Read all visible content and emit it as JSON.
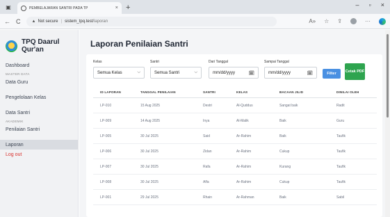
{
  "browser": {
    "tab_title": "PEMBELAJARAN SANTRI PADA TP",
    "tab_close": "×",
    "new_tab": "+",
    "window_controls": [
      "–",
      "▫",
      "×"
    ],
    "security": "Not secure",
    "url_host": "sistem_tpq.test",
    "url_path": "/laporan"
  },
  "sidebar": {
    "brand": "TPQ Daarul Qur'an",
    "items": {
      "dashboard": "Dashboard",
      "master_head": "MASTER DATA",
      "data_guru": "Data Guru",
      "pengelolaan_kelas": "Pengelolaan Kelas",
      "data_santri": "Data Santri",
      "akademik_head": "AKADEMIK",
      "penilaian_santri": "Penilaian Santri",
      "laporan": "Laporan",
      "logout": "Log out"
    }
  },
  "main": {
    "title": "Laporan Penilaian Santri",
    "filters": {
      "kelas_label": "Kelas",
      "kelas_value": "Semua Kelas",
      "santri_label": "Santri",
      "santri_value": "Semua Santri",
      "dari_label": "Dari Tanggal",
      "dari_placeholder": "mm/dd/yyyy",
      "sampai_label": "Sampai Tanggal",
      "sampai_placeholder": "mm/dd/yyyy",
      "filter_button": "Filter",
      "pdf_button": "Cetak PDF"
    },
    "table": {
      "headers": [
        "ID LAPORAN",
        "TANGGAL PENILAIAN",
        "SANTRI",
        "KELAS",
        "BACAAN JILID",
        "DINILAI OLEH"
      ],
      "rows": [
        [
          "LP-010",
          "15 Aug 2025",
          "Destri",
          "Al-Quddus",
          "Sangat baik",
          "Radit"
        ],
        [
          "LP-009",
          "14 Aug 2025",
          "Inya",
          "Al-Malik",
          "Baik",
          "Guru"
        ],
        [
          "LP-005",
          "30 Jul 2025",
          "Said",
          "Ar-Rahim",
          "Baik",
          "Taufik"
        ],
        [
          "LP-006",
          "30 Jul 2025",
          "Zidan",
          "Ar-Rahim",
          "Cukup",
          "Taufik"
        ],
        [
          "LP-007",
          "30 Jul 2025",
          "Rafa",
          "Ar-Rahim",
          "Kurang",
          "Taufik"
        ],
        [
          "LP-008",
          "30 Jul 2025",
          "Alfa",
          "Ar-Rahim",
          "Cukup",
          "Taufik"
        ],
        [
          "LP-001",
          "29 Jul 2025",
          "Rhain",
          "Ar-Rahman",
          "Baik",
          "Sabil"
        ]
      ]
    }
  }
}
